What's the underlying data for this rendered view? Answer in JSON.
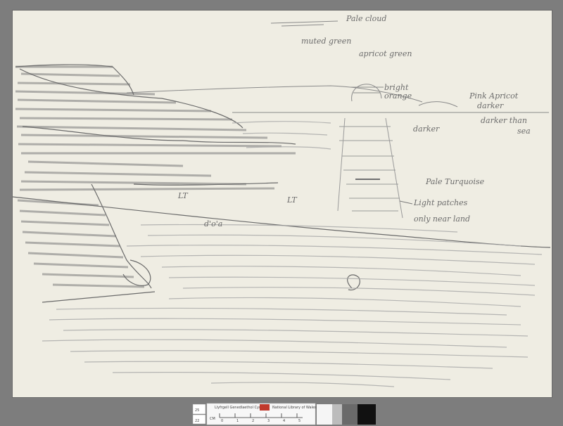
{
  "annotations": {
    "pale_cloud": "Pale cloud",
    "muted_green": "muted green",
    "apricot_green": "apricot green",
    "bright_orange_1": "bright",
    "bright_orange_2": "orange",
    "pink_apricot": "Pink Apricot",
    "darker_1": "darker",
    "darker_than_sea": "darker than",
    "sea": "sea",
    "darker_2": "darker",
    "pale_turquoise": "Pale Turquoise",
    "light_patches_1": "Light patches",
    "light_patches_2": "only near land",
    "lt_1": "LT",
    "lt_2": "LT",
    "dots": "d'o'a"
  },
  "footer": {
    "size_box_1": "25",
    "size_box_2": "22",
    "ruler_label_welsh": "Llyfrgell Genedlaethol Cymru",
    "ruler_label_english": "National Library of Wales",
    "ruler_unit": "CM",
    "ruler_ticks": [
      "0",
      "1",
      "2",
      "3",
      "4",
      "5"
    ]
  },
  "colors": {
    "background": "#7d7d7d",
    "paper": "#efede3",
    "pencil": "#8a8a8a",
    "swatches": [
      "#f5f5f5",
      "#bcbcbc",
      "#6a6a6a",
      "#111111"
    ]
  }
}
